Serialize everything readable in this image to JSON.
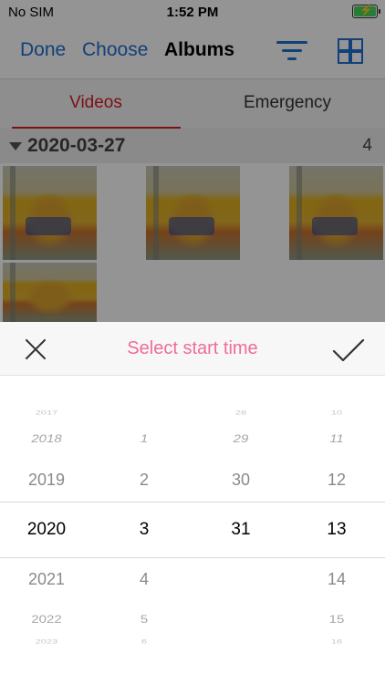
{
  "status_bar": {
    "carrier": "No SIM",
    "time": "1:52 PM"
  },
  "nav": {
    "done_label": "Done",
    "choose_label": "Choose",
    "title": "Albums"
  },
  "tabs": [
    {
      "label": "Videos",
      "active": true
    },
    {
      "label": "Emergency",
      "active": false
    }
  ],
  "section": {
    "date": "2020-03-27",
    "count": "4"
  },
  "picker": {
    "title": "Select start time",
    "year": {
      "items": [
        "2017",
        "2018",
        "2019",
        "2020",
        "2021",
        "2022",
        "2023"
      ],
      "selected": "2020"
    },
    "month": {
      "items": [
        "",
        "1",
        "2",
        "3",
        "4",
        "5",
        "6"
      ],
      "selected": "3"
    },
    "day": {
      "items": [
        "28",
        "29",
        "30",
        "31",
        "",
        "",
        ""
      ],
      "selected": "31"
    },
    "hour": {
      "items": [
        "10",
        "11",
        "12",
        "13",
        "14",
        "15",
        "16"
      ],
      "selected": "13"
    }
  },
  "colors": {
    "accent_blue": "#1f6fd1",
    "accent_red": "#d81e24",
    "title_pink": "#ef6d96",
    "battery_green": "#47d65c"
  }
}
